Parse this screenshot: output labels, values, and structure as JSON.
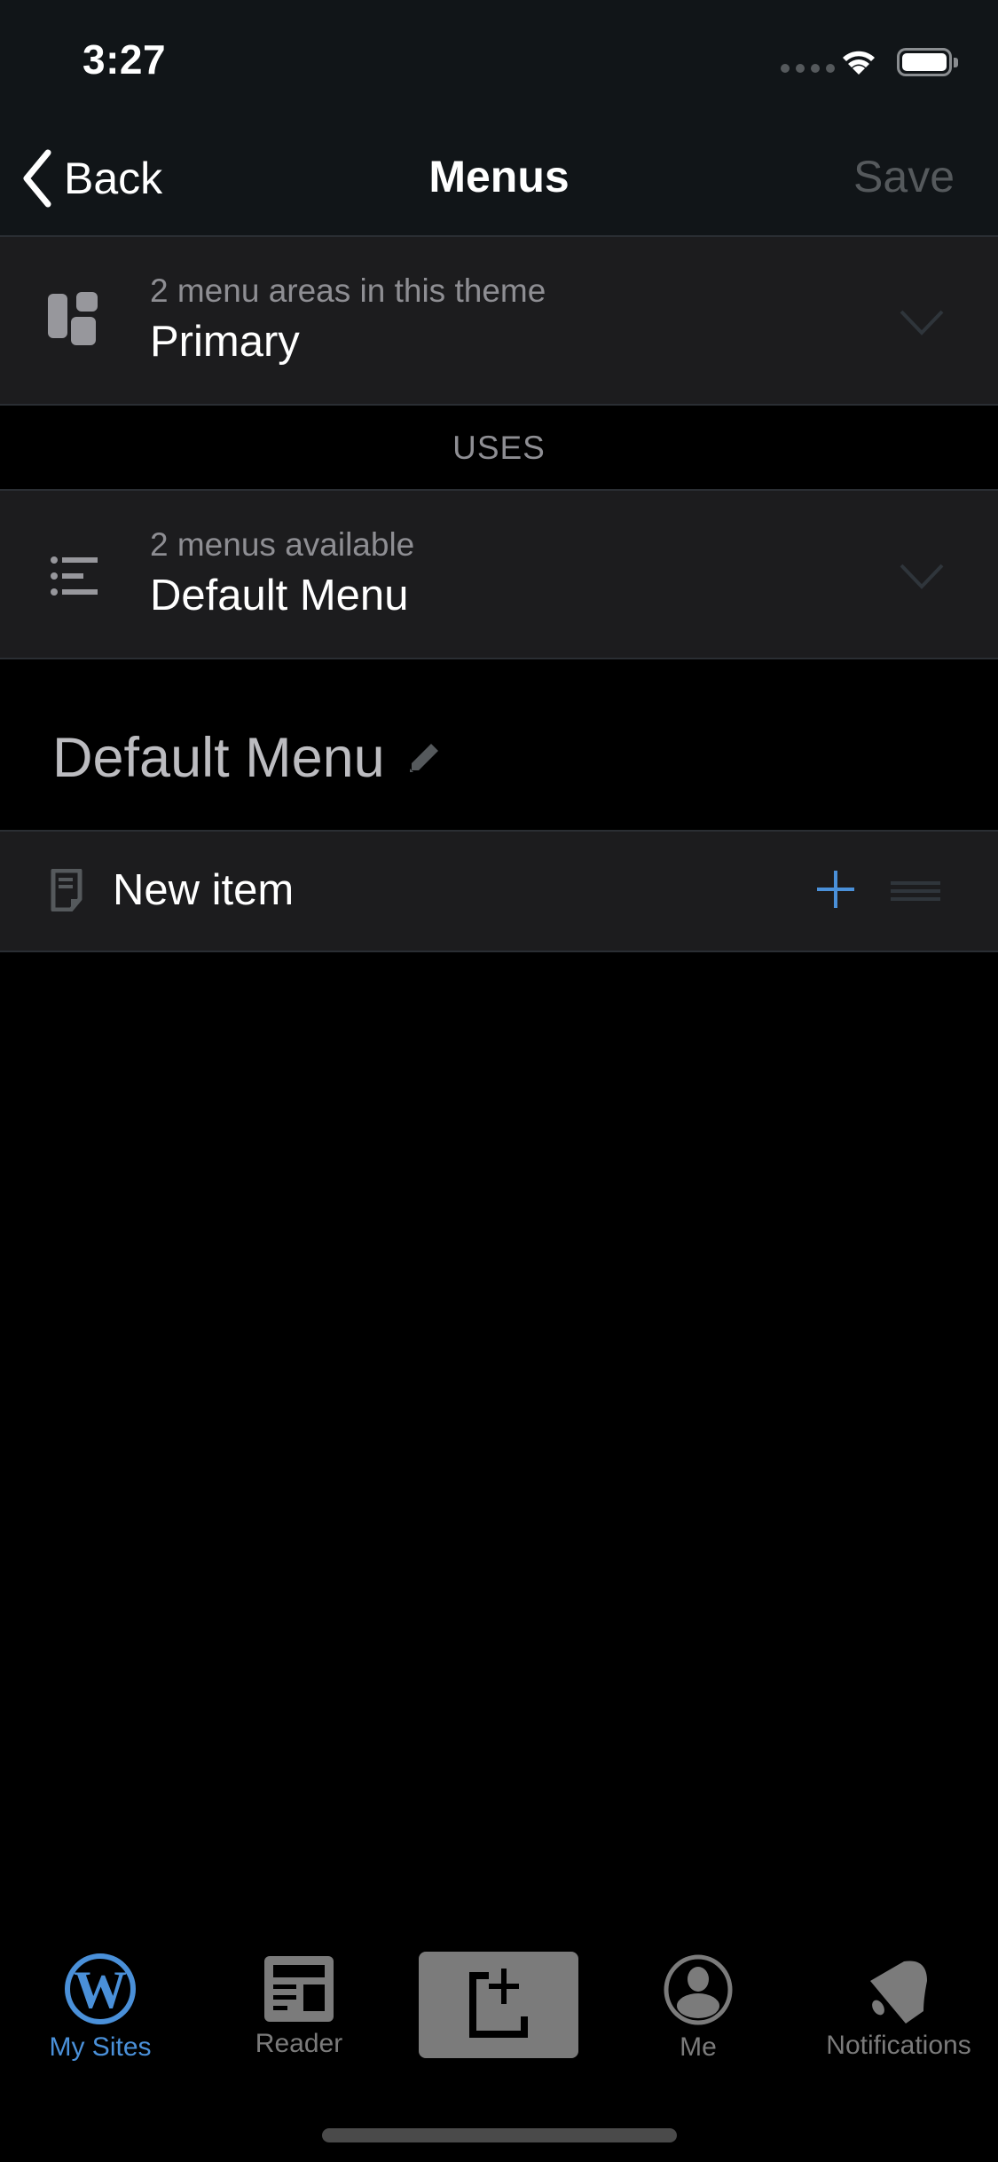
{
  "status_bar": {
    "time": "3:27"
  },
  "nav": {
    "back_label": "Back",
    "title": "Menus",
    "save_label": "Save"
  },
  "location_cell": {
    "subtitle": "2 menu areas in this theme",
    "value": "Primary"
  },
  "uses_header": "USES",
  "menu_cell": {
    "subtitle": "2 menus available",
    "value": "Default Menu"
  },
  "menu_name": "Default Menu",
  "menu_items": [
    {
      "label": "New item"
    }
  ],
  "tab_bar": {
    "items": [
      {
        "label": "My Sites",
        "active": true
      },
      {
        "label": "Reader",
        "active": false
      },
      {
        "label": "",
        "active": false
      },
      {
        "label": "Me",
        "active": false
      },
      {
        "label": "Notifications",
        "active": false
      }
    ]
  },
  "colors": {
    "accent": "#4a90d9",
    "inactive": "#7b7b7b",
    "cell_bg": "#1c1c1e",
    "nav_bg": "#111518"
  }
}
